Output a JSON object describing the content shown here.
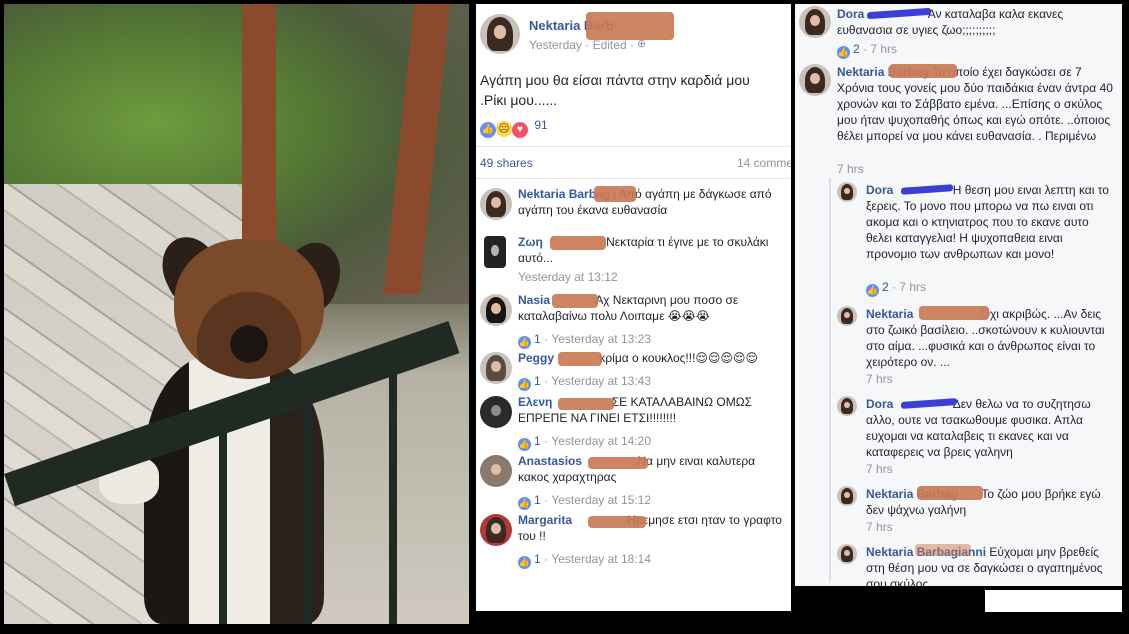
{
  "post": {
    "author": "Nektaria Barb",
    "timestamp": "Yesterday · Edited · ",
    "text": "Αγάπη μου θα είσαι πάντα στην καρδιά μου .Ρίκι μου......",
    "reactions_count": "91",
    "shares": "49 shares",
    "comments_count": "14 comme"
  },
  "comments": [
    {
      "author": "Nektaria Barbag",
      "text": "ι Από αγάπη με δάγκωσε από αγάπη του έκανα ευθανασία",
      "likes": "",
      "time": ""
    },
    {
      "author": "Ζωη",
      "text": "Νεκταρία τι έγινε με το σκυλάκι αυτό...",
      "likes": "",
      "time": "Yesterday at 13:12"
    },
    {
      "author": "Nasia",
      "text": "Αχ Νεκταρινη μου ποσο σε καταλαβαίνω πολυ Λοιπαμε 😭😭😭",
      "likes": "1",
      "time": "Yesterday at 13:23"
    },
    {
      "author": "Peggy",
      "text": "κρίμα ο κουκλος!!!😌😌😌😌😌",
      "likes": "1",
      "time": "Yesterday at 13:43"
    },
    {
      "author": "Ελενη",
      "text": "ΣΕ ΚΑΤΑΛΑΒΑΙΝΩ ΟΜΩΣ ΕΠΡΕΠΕ ΝΑ ΓΙΝΕΙ ΕΤΣΙ!!!!!!!!",
      "likes": "1",
      "time": "Yesterday at 14:20"
    },
    {
      "author": "Anastasios",
      "text": "Να μην ειναι καλυτερα κακος χαραχτηρας",
      "likes": "1",
      "time": "Yesterday at 15:12"
    },
    {
      "author": "Margarita",
      "text": "Ηρεμησε ετσι ηταν το γραφτο του !!",
      "likes": "1",
      "time": "Yesterday at 18:14"
    }
  ],
  "thread": [
    {
      "author": "Dora",
      "text": "Αν καταλαβα καλα εκανες ευθανασια σε υγιες ζωο;;;;;;;;;;",
      "likes": "2",
      "time": "7 hrs"
    },
    {
      "author": "Nektaria Barbag",
      "text": "Το οποίο έχει δαγκώσει σε 7 Χρόνια τους γονείς μου δύο παιδάκια έναν άντρα 40 χρονών και το Σάββατο εμένα. ...Επίσης ο σκύλος μου ήταν ψυχοπαθής όπως και εγώ οπότε. ..όποιος θέλει μπορεί να μου κάνει ευθανασία. . Περιμένω",
      "likes": "",
      "time": "7 hrs"
    },
    {
      "author": "Dora",
      "text": "Η θεση μου ειναι λεπτη και το ξερεις. Το μονο που μπορω να πω ειναι οτι ακομα και ο κτηνιατρος που το εκανε αυτο θελει καταγγελια! Η ψυχοπαθεια ειναι προνομιο των ανθρωπων και μονο!",
      "likes": "2",
      "time": "7 hrs"
    },
    {
      "author": "Nektaria",
      "text": "Όχι ακριβώς. ...Αν δεις στο ζωικό βασίλειο. ..σκοτώνουν κ κυλιουνται στο αίμα. ...φυσικά και ο άνθρωπος είναι το χειρότερο ον. ...",
      "likes": "",
      "time": "7 hrs"
    },
    {
      "author": "Dora",
      "text": "Δεν θελω να το συζητησω αλλο, ουτε να τσακωθουμε φυσικα. Απλα ευχομαι να καταλαβεις τι εκανες και να καταφερεις να βρεις γαληνη",
      "likes": "",
      "time": "7 hrs"
    },
    {
      "author": "Nektaria Barbag",
      "text": "Το ζώο μου βρήκε εγώ δεν ψάχνω γαλήνη",
      "likes": "",
      "time": "7 hrs"
    },
    {
      "author": "Nektaria Barbagianni",
      "text": "Εύχομαι μην βρεθείς στη θέση μου να σε δαγκώσει ο αγαπημένος σου σκύλος. ..",
      "likes": "",
      "time": ""
    }
  ],
  "colors": {
    "link": "#365899",
    "meta": "#90949c",
    "like": "#5890ff",
    "redaction": "#c97a55",
    "redaction_blue": "#3b3fd8"
  }
}
